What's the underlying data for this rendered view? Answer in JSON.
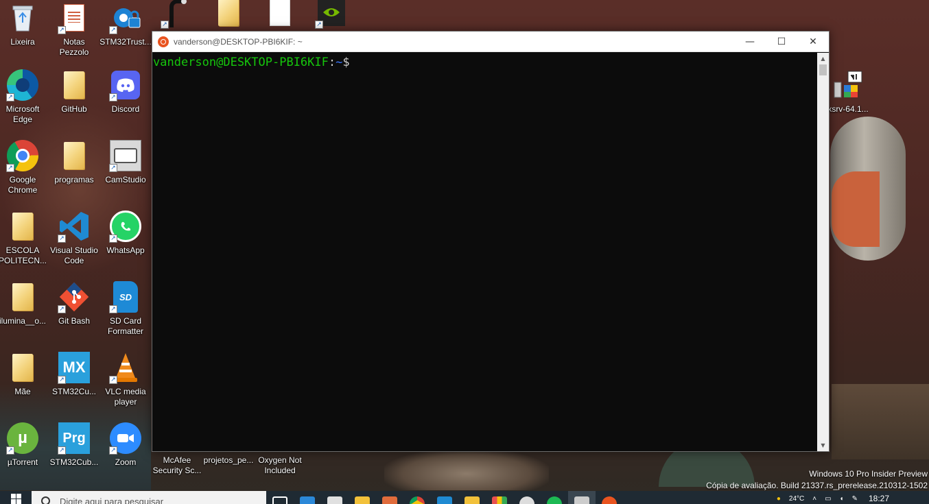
{
  "desktop": {
    "icons": [
      {
        "label": "Lixeira",
        "icon": "recycle-bin-icon"
      },
      {
        "label": "Notas Pezzolo",
        "icon": "document-icon"
      },
      {
        "label": "STM32Trust...",
        "icon": "gear-lock-icon"
      },
      {
        "label": "",
        "icon": "dark-app-icon"
      },
      {
        "label": "",
        "icon": "folder-icon"
      },
      {
        "label": "",
        "icon": "blank-document-icon"
      },
      {
        "label": "",
        "icon": "nvidia-icon"
      },
      {
        "label": "Microsoft Edge",
        "icon": "edge-icon"
      },
      {
        "label": "GitHub",
        "icon": "folder-icon"
      },
      {
        "label": "Discord",
        "icon": "discord-icon"
      },
      {
        "label": "Google Chrome",
        "icon": "chrome-icon"
      },
      {
        "label": "programas",
        "icon": "folder-icon"
      },
      {
        "label": "CamStudio",
        "icon": "camstudio-icon"
      },
      {
        "label": "ESCOLA POLITECN...",
        "icon": "folder-icon"
      },
      {
        "label": "Visual Studio Code",
        "icon": "vscode-icon"
      },
      {
        "label": "WhatsApp",
        "icon": "whatsapp-icon"
      },
      {
        "label": "ilumina__o...",
        "icon": "folder-icon"
      },
      {
        "label": "Git Bash",
        "icon": "git-icon"
      },
      {
        "label": "SD Card Formatter",
        "icon": "sd-card-icon"
      },
      {
        "label": "Mãe",
        "icon": "folder-icon"
      },
      {
        "label": "STM32Cu...",
        "icon": "stm32cubemx-icon"
      },
      {
        "label": "VLC media player",
        "icon": "vlc-icon"
      },
      {
        "label": "µTorrent",
        "icon": "utorrent-icon"
      },
      {
        "label": "STM32Cub...",
        "icon": "stm32cubeprog-icon"
      },
      {
        "label": "Zoom",
        "icon": "zoom-icon"
      },
      {
        "label": "McAfee Security Sc...",
        "icon": "mcafee-icon"
      },
      {
        "label": "projetos_pe...",
        "icon": "folder-icon"
      },
      {
        "label": "Oxygen Not Included",
        "icon": "game-icon"
      },
      {
        "label": "xsrv-64.1...",
        "icon": "vcxsrv-icon"
      }
    ],
    "icon_text": {
      "mx": "MX",
      "prg": "Prg",
      "sd": "SD"
    }
  },
  "terminal": {
    "title": "vanderson@DESKTOP-PBI6KIF: ~",
    "prompt_user": "vanderson@DESKTOP-PBI6KIF",
    "prompt_colon": ":",
    "prompt_path": "~",
    "prompt_symbol": "$",
    "minimize_glyph": "—",
    "maximize_glyph": "☐",
    "close_glyph": "✕",
    "scroll_up_glyph": "▲",
    "scroll_down_glyph": "▼"
  },
  "watermark": {
    "line1": "Windows 10 Pro Insider Preview",
    "line2": "Cópia de avaliação. Build 21337.rs_prerelease.210312-1502"
  },
  "taskbar": {
    "search_placeholder": "Digite aqui para pesquisar",
    "weather": "24°C",
    "clock": "18:27",
    "pinned": [
      {
        "icon": "task-view-icon",
        "color": "#ffffff"
      },
      {
        "icon": "mail-icon",
        "color": "#2b88d8"
      },
      {
        "icon": "store-icon",
        "color": "#e0e0e0"
      },
      {
        "icon": "file-explorer-icon",
        "color": "#f2c13a"
      },
      {
        "icon": "paint-icon",
        "color": "#e06c3c"
      },
      {
        "icon": "chrome-icon",
        "color": "#db4437"
      },
      {
        "icon": "vscode-icon",
        "color": "#1f8ad2"
      },
      {
        "icon": "folder-icon",
        "color": "#f2c13a"
      },
      {
        "icon": "color-grid-icon",
        "color": "#e84f4f"
      },
      {
        "icon": "github-icon",
        "color": "#dddddd"
      },
      {
        "icon": "spotify-icon",
        "color": "#1db954"
      },
      {
        "icon": "terminal-icon",
        "color": "#cccccc"
      },
      {
        "icon": "ubuntu-icon",
        "color": "#e95420"
      }
    ]
  }
}
